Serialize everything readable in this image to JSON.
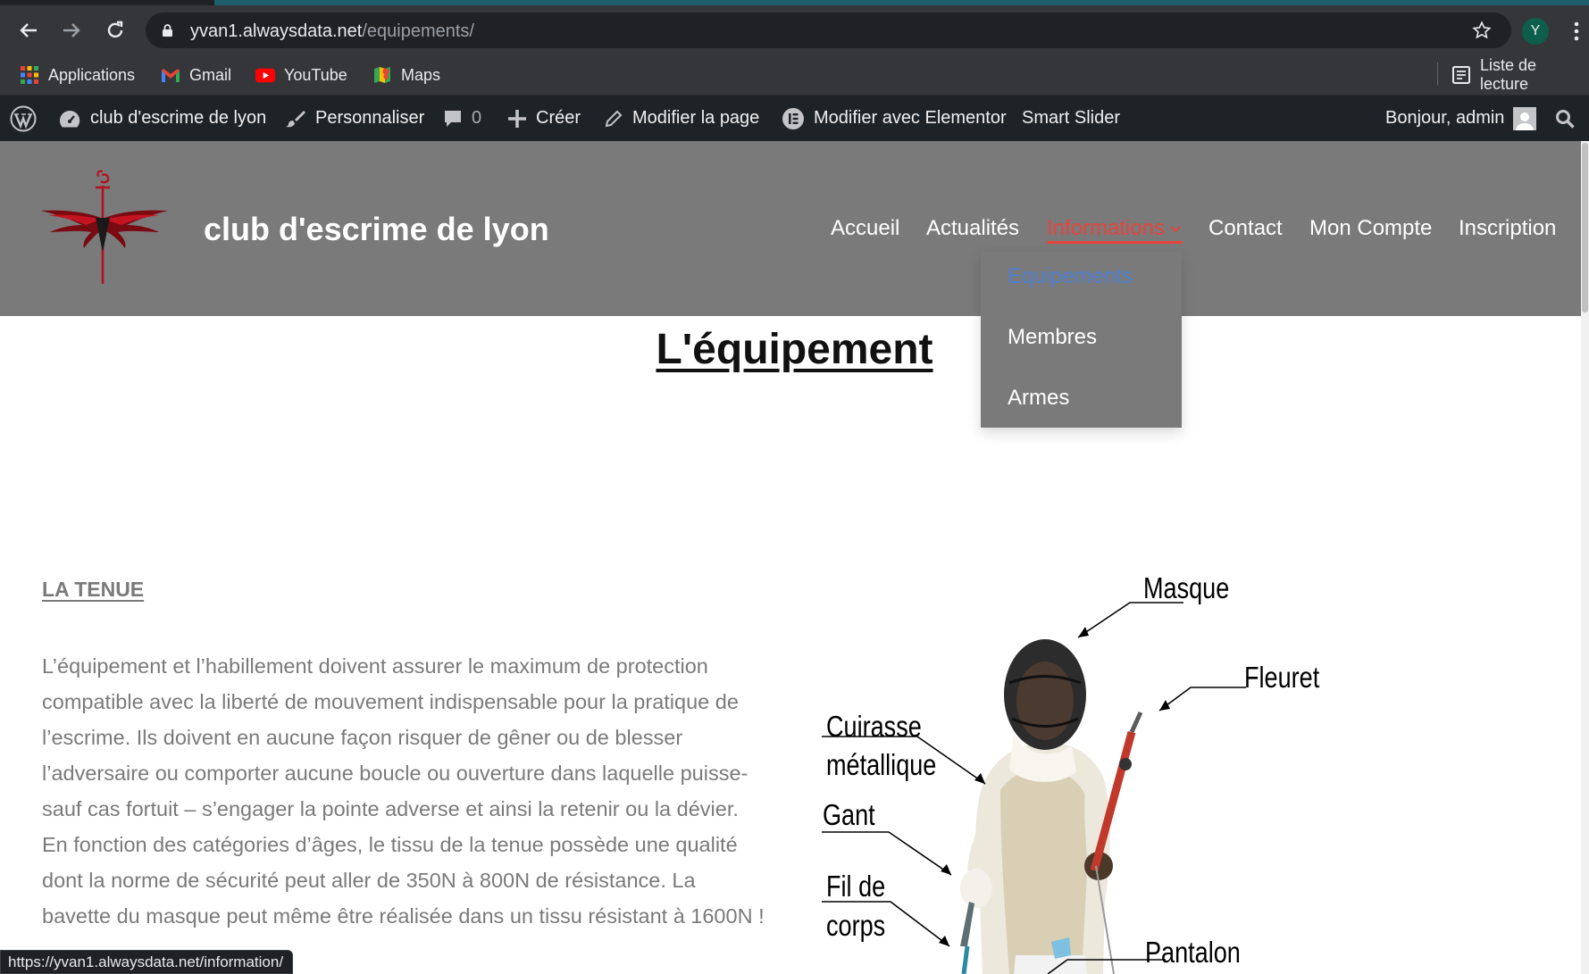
{
  "browser": {
    "url_host": "yvan1.alwaysdata.net",
    "url_path": "/equipements/",
    "profile_initial": "Y",
    "bookmarks": [
      {
        "label": "Applications",
        "icon": "apps-grid-icon"
      },
      {
        "label": "Gmail",
        "icon": "gmail-icon"
      },
      {
        "label": "YouTube",
        "icon": "youtube-icon"
      },
      {
        "label": "Maps",
        "icon": "maps-icon"
      }
    ],
    "reading_list": "Liste de lecture",
    "status_url": "https://yvan1.alwaysdata.net/information/"
  },
  "adminbar": {
    "site_name": "club d'escrime de lyon",
    "customize": "Personnaliser",
    "comments_count": "0",
    "new": "Créer",
    "edit_page": "Modifier la page",
    "edit_elementor": "Modifier avec Elementor",
    "smart_slider": "Smart Slider",
    "greeting": "Bonjour, admin"
  },
  "site": {
    "title": "club d'escrime de lyon",
    "menu": [
      "Accueil",
      "Actualités",
      "Informations",
      "Contact",
      "Mon Compte",
      "Inscription"
    ],
    "submenu": [
      "Equipements",
      "Membres",
      "Armes"
    ],
    "accent_color": "#e5453d",
    "header_color": "#7a7a7a",
    "submenu_current_color": "#4f7fd0"
  },
  "content": {
    "page_title": "L'équipement",
    "section_heading": "LA TENUE",
    "paragraph_lines": [
      "L’équipement et l’habillement doivent assurer le maximum de protection",
      "compatible avec la liberté de mouvement indispensable pour la pratique de",
      "l’escrime. Ils doivent en aucune façon risquer de gêner ou de blesser",
      "l’adversaire ou comporter aucune boucle ou ouverture dans laquelle puisse-",
      "sauf cas fortuit – s’engager la pointe adverse et ainsi la retenir ou la dévier.",
      "En fonction des catégories d’âges, le tissu de la tenue possède une qualité",
      "dont la norme de sécurité peut aller de 350N à 800N de résistance. La",
      "bavette du masque peut même être réalisée dans un tissu résistant à 1600N !"
    ],
    "figure_labels": {
      "masque": "Masque",
      "fleuret": "Fleuret",
      "cuirasse_1": "Cuirasse",
      "cuirasse_2": "métallique",
      "gant": "Gant",
      "fil_1": "Fil de",
      "fil_2": "corps",
      "pantalon": "Pantalon"
    }
  }
}
